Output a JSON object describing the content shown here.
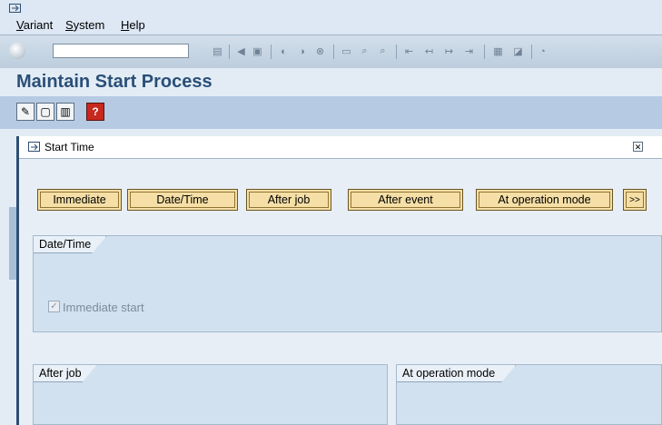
{
  "menu": {
    "items": [
      "Variant",
      "System",
      "Help"
    ]
  },
  "toolbar": {
    "command_value": ""
  },
  "page": {
    "title": "Maintain Start Process"
  },
  "dialog": {
    "title": "Start Time",
    "buttons": {
      "immediate": "Immediate",
      "date_time": "Date/Time",
      "after_job": "After job",
      "after_event": "After event",
      "at_operation_mode": "At operation mode",
      "more": ">>"
    },
    "groups": {
      "date_time": {
        "title": "Date/Time",
        "checkbox_label": "Immediate start",
        "checkbox_checked": true
      },
      "after_job": {
        "title": "After job"
      },
      "at_operation_mode": {
        "title": "At operation mode"
      }
    }
  },
  "icons": {
    "exit": "exit-icon",
    "okcode": "enter-icon",
    "toolbar": [
      "back-icon",
      "save-icon",
      "green-back-icon",
      "exit-icon",
      "cancel-icon",
      "print-icon",
      "find-icon",
      "find-next-icon",
      "first-page-icon",
      "previous-page-icon",
      "next-page-icon",
      "last-page-icon",
      "create-session-icon",
      "shortcut-icon"
    ],
    "app": [
      "change-icon",
      "create-icon",
      "delete-icon",
      "help-icon"
    ]
  },
  "colors": {
    "page_title": "#2a4f78",
    "button_fill": "#f6dfa6",
    "group_fill": "#d2e1ef",
    "dialog_border": "#2d4f73"
  }
}
